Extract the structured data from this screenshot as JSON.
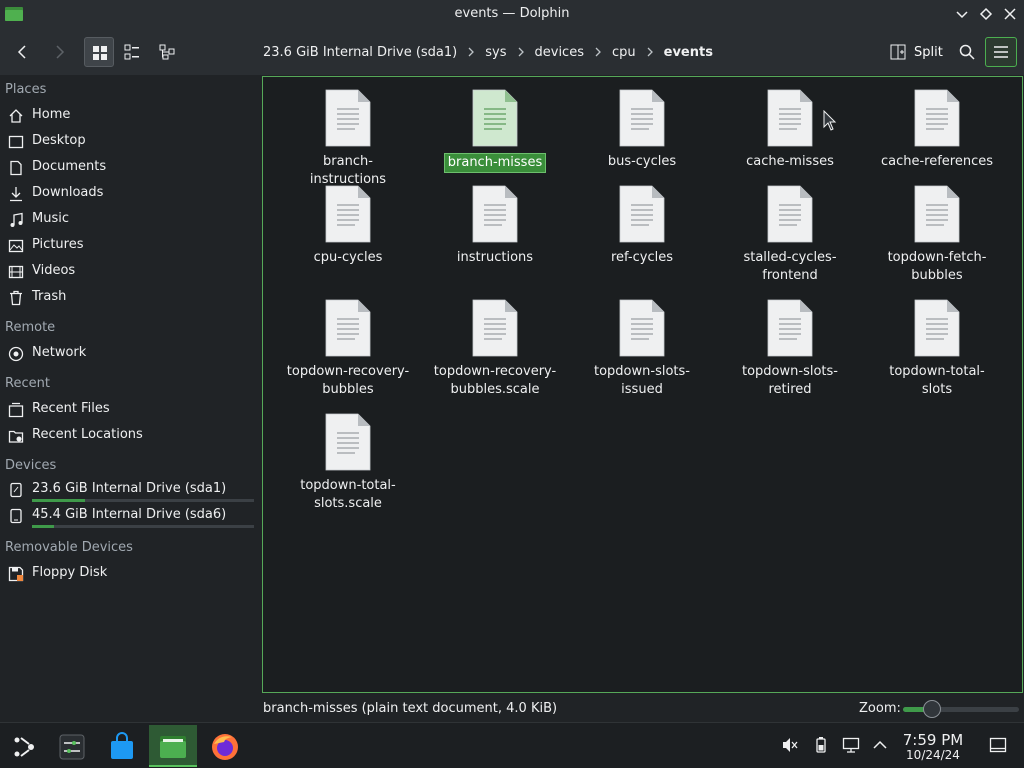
{
  "window": {
    "title": "events — Dolphin"
  },
  "toolbar": {
    "breadcrumb": [
      "23.6 GiB Internal Drive (sda1)",
      "sys",
      "devices",
      "cpu",
      "events"
    ],
    "split_label": "Split"
  },
  "sidebar": {
    "sections": {
      "places": "Places",
      "remote": "Remote",
      "recent": "Recent",
      "devices": "Devices",
      "removable": "Removable Devices"
    },
    "places": [
      "Home",
      "Desktop",
      "Documents",
      "Downloads",
      "Music",
      "Pictures",
      "Videos",
      "Trash"
    ],
    "remote": [
      "Network"
    ],
    "recent": [
      "Recent Files",
      "Recent Locations"
    ],
    "devices": [
      {
        "label": "23.6 GiB Internal Drive (sda1)",
        "usage_fraction": 0.24
      },
      {
        "label": "45.4 GiB Internal Drive (sda6)",
        "usage_fraction": 0.1
      }
    ],
    "removable": [
      "Floppy Disk"
    ]
  },
  "files": [
    {
      "name": "branch-instructions",
      "selected": false
    },
    {
      "name": "branch-misses",
      "selected": true
    },
    {
      "name": "bus-cycles",
      "selected": false
    },
    {
      "name": "cache-misses",
      "selected": false
    },
    {
      "name": "cache-references",
      "selected": false
    },
    {
      "name": "cpu-cycles",
      "selected": false
    },
    {
      "name": "instructions",
      "selected": false
    },
    {
      "name": "ref-cycles",
      "selected": false
    },
    {
      "name": "stalled-cycles-frontend",
      "selected": false
    },
    {
      "name": "topdown-fetch-bubbles",
      "selected": false
    },
    {
      "name": "topdown-recovery-bubbles",
      "selected": false
    },
    {
      "name": "topdown-recovery-bubbles.scale",
      "selected": false
    },
    {
      "name": "topdown-slots-issued",
      "selected": false
    },
    {
      "name": "topdown-slots-retired",
      "selected": false
    },
    {
      "name": "topdown-total-slots",
      "selected": false
    },
    {
      "name": "topdown-total-slots.scale",
      "selected": false
    }
  ],
  "statusbar": {
    "text": "branch-misses (plain text document, 4.0 KiB)",
    "zoom_label": "Zoom:",
    "zoom_fraction": 0.25
  },
  "taskbar": {
    "time": "7:59 PM",
    "date": "10/24/24"
  },
  "colors": {
    "accent": "#4caf50",
    "selection": "#3a8e3a"
  }
}
